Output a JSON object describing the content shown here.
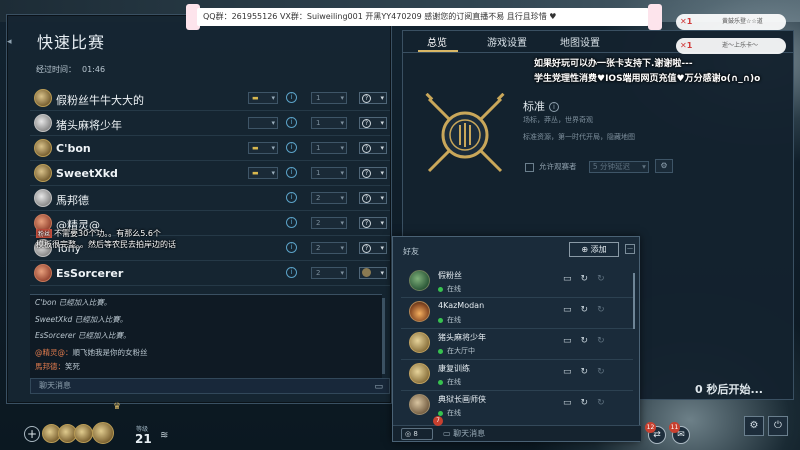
{
  "top_overlay": {
    "marquee": "QQ群：261955126  VX群：Suiweiling001  开黑YY470209  感谢您的订阅直播不易 且行且珍惜 ♥",
    "viewer_badges": [
      "黄鼓乐登☆☆道",
      "逝～上乐卡～"
    ],
    "viewer_badge_marks": [
      "✕1",
      "✕1"
    ]
  },
  "left_panel": {
    "title": "快速比赛",
    "elapsed_label": "经过时间：",
    "elapsed_value": "01:46",
    "players": [
      {
        "name": "假粉丝牛牛大大的",
        "flag": "▬",
        "team": "1",
        "color": "?",
        "avatar": "gold"
      },
      {
        "name": "猪头麻将少年",
        "flag": "",
        "team": "1",
        "color": "?",
        "avatar": "silver"
      },
      {
        "name": "C'bon",
        "flag": "▬",
        "team": "1",
        "color": "?",
        "avatar": "gold"
      },
      {
        "name": "SweetXkd",
        "flag": "▬",
        "team": "1",
        "color": "?",
        "avatar": "gold"
      },
      {
        "name": "馬邦德",
        "flag": "",
        "team": "2",
        "color": "?",
        "avatar": "silver"
      },
      {
        "name": "@精灵@",
        "flag": "",
        "team": "2",
        "color": "?",
        "avatar": "red"
      },
      {
        "name": "Tony",
        "flag": "",
        "team": "2",
        "color": "?",
        "avatar": "silver"
      },
      {
        "name": "EsSorcerer",
        "flag": "",
        "team": "2",
        "color": "",
        "avatar": "red"
      }
    ],
    "danmaku": [
      {
        "tag": "粉丝",
        "text": "不需要30个功。。有那么5.6个"
      },
      {
        "tag": "",
        "text": "模板很完整。。然后等农民去拍岸边的话"
      }
    ],
    "chat_log": [
      {
        "who": "",
        "text": "C'bon 已經加入比賽。"
      },
      {
        "who": "",
        "text": "SweetXkd 已經加入比賽。"
      },
      {
        "who": "",
        "text": "EsSorcerer 已經加入比賽。"
      },
      {
        "who": "@精灵@：",
        "text": "順飞她我是你的女粉丝"
      },
      {
        "who": "馬邦德：",
        "text": "笑死"
      }
    ],
    "chat_placeholder": "聊天消息"
  },
  "right_panel": {
    "tabs": [
      "总览",
      "游戏设置",
      "地图设置"
    ],
    "banner_line1": "如果好玩可以办一张卡支持下.谢谢啦---",
    "banner_line2": "学生党理性消费♥IOS端用网页充值♥万分感谢o(∩_∩)o",
    "mode_title": "标准",
    "mode_desc": "场标，莽丛，世界奇观",
    "mode_desc2": "标准资源，第一时代开局，隐藏地图",
    "spectator_label": "允许观赛者",
    "spectator_select": "5 分钟延迟",
    "countdown": "0 秒后开始..."
  },
  "friends_panel": {
    "title": "好友",
    "add_label": "添加",
    "friends": [
      {
        "name": "假粉丝",
        "status": "在线",
        "avatar": "green"
      },
      {
        "name": "4KazModan",
        "status": "在线",
        "avatar": "sunset"
      },
      {
        "name": "猪头麻将少年",
        "status": "在大厅中",
        "avatar": "gold"
      },
      {
        "name": "康复训练",
        "status": "在线",
        "avatar": "gold"
      },
      {
        "name": "典狱长画师侠",
        "status": "在线",
        "avatar": "sepia"
      }
    ],
    "online_count": "8",
    "unread_badge": "7",
    "chat_label": "聊天消息"
  },
  "bottom_bar": {
    "level_label": "等级",
    "level": "21",
    "notif_badges": [
      "12",
      "11"
    ]
  },
  "colors": {
    "accent_gold": "#d8b766",
    "online_green": "#37c24f",
    "badge_red": "#c8402f"
  }
}
